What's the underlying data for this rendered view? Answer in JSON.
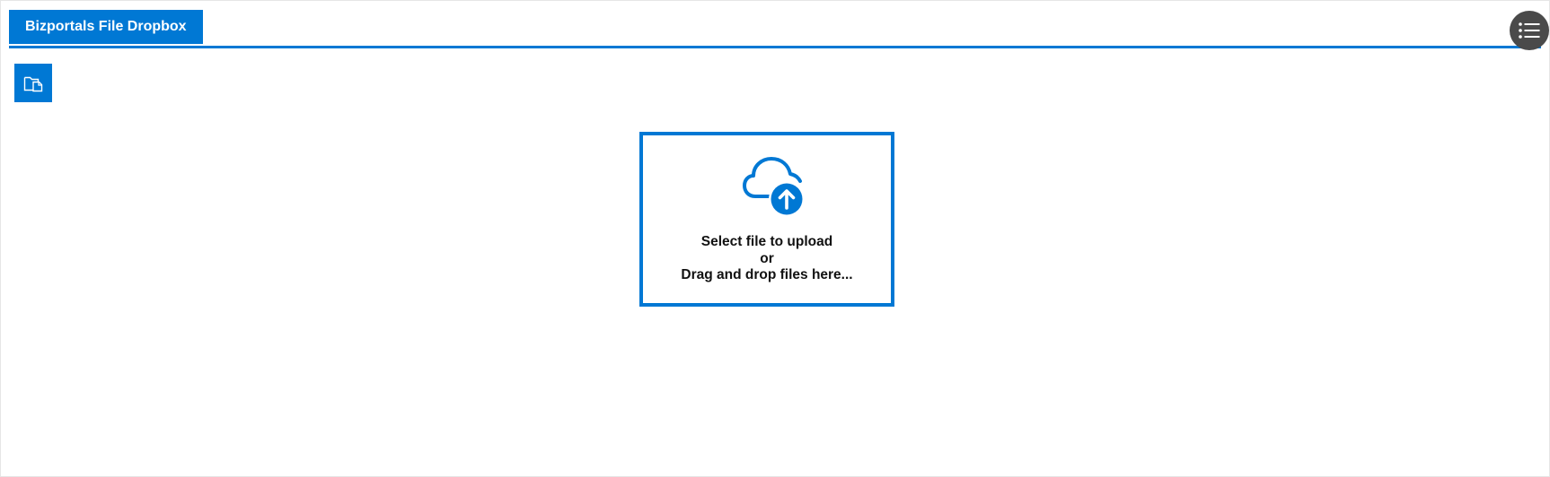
{
  "header": {
    "title": "Bizportals File Dropbox",
    "menu_icon": "list-icon"
  },
  "toolbar": {
    "folder_icon": "folder-icon"
  },
  "dropzone": {
    "icon": "cloud-upload-icon",
    "line1": "Select file to upload",
    "line2": "or",
    "line3": "Drag and drop files here..."
  },
  "colors": {
    "accent": "#0078d4",
    "menu_button": "#4a4a4a",
    "text": "#111111"
  }
}
